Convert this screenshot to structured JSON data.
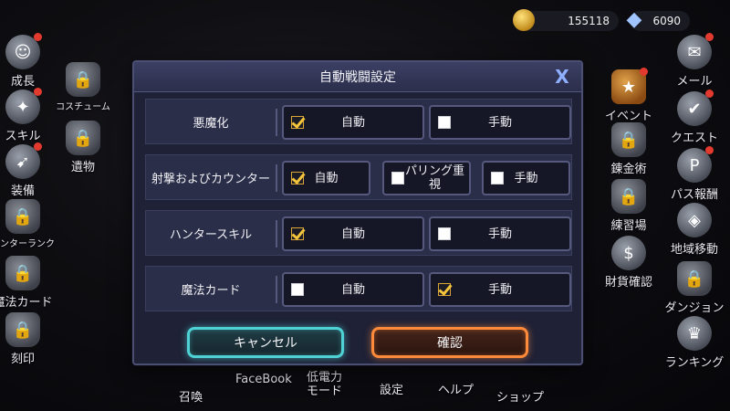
{
  "currency": {
    "gold": "155118",
    "gems": "6090"
  },
  "left_menu": [
    {
      "label": "成長",
      "icon": "growth-icon"
    },
    {
      "label": "スキル",
      "icon": "skill-icon"
    },
    {
      "label": "装備",
      "icon": "equipment-icon"
    },
    {
      "label": "ハンターランク",
      "icon": "lock-icon"
    },
    {
      "label": "魔法カード",
      "icon": "lock-icon"
    },
    {
      "label": "刻印",
      "icon": "lock-icon"
    }
  ],
  "left_menu2": [
    {
      "label": "コスチューム",
      "icon": "lock-icon"
    },
    {
      "label": "遺物",
      "icon": "lock-icon"
    }
  ],
  "right_menu": [
    {
      "label": "メール",
      "icon": "mail-icon"
    },
    {
      "label": "クエスト",
      "icon": "quest-icon"
    },
    {
      "label": "パス報酬",
      "icon": "pass-icon"
    },
    {
      "label": "地域移動",
      "icon": "region-icon"
    },
    {
      "label": "ダンジョン",
      "icon": "lock-icon"
    },
    {
      "label": "ランキング",
      "icon": "ranking-icon"
    }
  ],
  "right_menu2": [
    {
      "label": "イベント",
      "icon": "event-icon"
    },
    {
      "label": "錬金術",
      "icon": "lock-icon"
    },
    {
      "label": "練習場",
      "icon": "lock-icon"
    },
    {
      "label": "財貨確認",
      "icon": "currency-check-icon"
    }
  ],
  "bottom_menu": [
    "召喚",
    "FaceBook",
    "低電力\nモード",
    "設定",
    "ヘルプ",
    "ショップ"
  ],
  "dialog": {
    "title": "自動戦闘設定",
    "close": "X",
    "rows": [
      {
        "label": "悪魔化",
        "options": [
          {
            "text": "自動",
            "checked": true
          },
          {
            "text": "手動",
            "checked": false
          }
        ]
      },
      {
        "label": "射撃およびカウンター",
        "options": [
          {
            "text": "自動",
            "checked": true
          },
          {
            "text": "パリング重\n視",
            "checked": false
          },
          {
            "text": "手動",
            "checked": false
          }
        ]
      },
      {
        "label": "ハンタースキル",
        "options": [
          {
            "text": "自動",
            "checked": true
          },
          {
            "text": "手動",
            "checked": false
          }
        ]
      },
      {
        "label": "魔法カード",
        "options": [
          {
            "text": "自動",
            "checked": false
          },
          {
            "text": "手動",
            "checked": true
          }
        ]
      }
    ],
    "cancel_label": "キャンセル",
    "confirm_label": "確認"
  },
  "colors": {
    "accent_check": "#f3c43c",
    "cancel_glow": "#4fd2d6",
    "confirm_glow": "#ff8a3a"
  }
}
